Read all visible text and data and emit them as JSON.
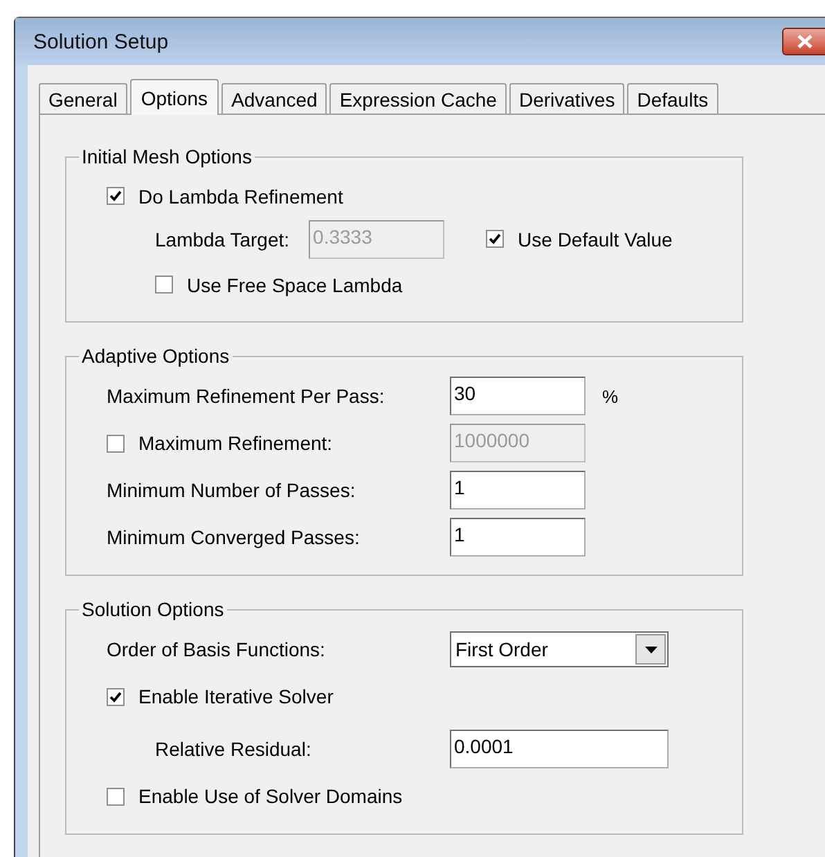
{
  "window": {
    "title": "Solution Setup"
  },
  "tabs": [
    {
      "label": "General",
      "selected": false
    },
    {
      "label": "Options",
      "selected": true
    },
    {
      "label": "Advanced",
      "selected": false
    },
    {
      "label": "Expression Cache",
      "selected": false
    },
    {
      "label": "Derivatives",
      "selected": false
    },
    {
      "label": "Defaults",
      "selected": false
    }
  ],
  "groups": [
    {
      "title": "Initial Mesh Options",
      "rows": [
        {
          "kind": "checkbox",
          "label": "Do Lambda Refinement",
          "checked": true,
          "children": [
            {
              "kind": "field",
              "label": "Lambda Target:",
              "value": "0.3333",
              "disabled": true,
              "side_checkbox": {
                "label": "Use Default Value",
                "checked": true
              }
            },
            {
              "kind": "checkbox",
              "label": "Use Free Space Lambda",
              "checked": false
            }
          ]
        }
      ]
    },
    {
      "title": "Adaptive Options",
      "rows": [
        {
          "kind": "field",
          "label": "Maximum Refinement Per Pass:",
          "value": "30",
          "disabled": false,
          "unit": "%"
        },
        {
          "kind": "checkfield",
          "label": "Maximum Refinement:",
          "checked": false,
          "value": "1000000",
          "disabled": true
        },
        {
          "kind": "field",
          "label": "Minimum Number of Passes:",
          "value": "1",
          "disabled": false
        },
        {
          "kind": "field",
          "label": "Minimum Converged Passes:",
          "value": "1",
          "disabled": false
        }
      ]
    },
    {
      "title": "Solution Options",
      "rows": [
        {
          "kind": "dropdown",
          "label": "Order of Basis Functions:",
          "value": "First Order"
        },
        {
          "kind": "checkbox",
          "label": "Enable Iterative Solver",
          "checked": true,
          "children": [
            {
              "kind": "field",
              "label": "Relative Residual:",
              "value": "0.0001",
              "disabled": false
            }
          ]
        },
        {
          "kind": "checkbox",
          "label": "Enable Use of Solver Domains",
          "checked": false
        }
      ]
    }
  ]
}
